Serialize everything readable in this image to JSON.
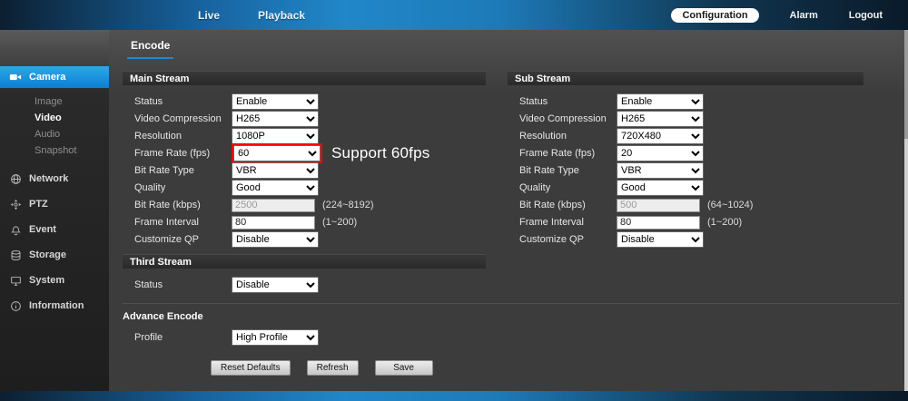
{
  "topbar": {
    "live": "Live",
    "playback": "Playback",
    "configuration": "Configuration",
    "alarm": "Alarm",
    "logout": "Logout"
  },
  "sidebar": {
    "camera": {
      "label": "Camera"
    },
    "camera_children": [
      {
        "label": "Image"
      },
      {
        "label": "Video"
      },
      {
        "label": "Audio"
      },
      {
        "label": "Snapshot"
      }
    ],
    "items": [
      {
        "label": "Network"
      },
      {
        "label": "PTZ"
      },
      {
        "label": "Event"
      },
      {
        "label": "Storage"
      },
      {
        "label": "System"
      },
      {
        "label": "Information"
      }
    ]
  },
  "page": {
    "tab": "Encode"
  },
  "main_stream": {
    "title": "Main Stream",
    "status": {
      "label": "Status",
      "value": "Enable"
    },
    "compression": {
      "label": "Video Compression",
      "value": "H265"
    },
    "resolution": {
      "label": "Resolution",
      "value": "1080P"
    },
    "framerate": {
      "label": "Frame Rate (fps)",
      "value": "60"
    },
    "bitrate_type": {
      "label": "Bit Rate Type",
      "value": "VBR"
    },
    "quality": {
      "label": "Quality",
      "value": "Good"
    },
    "bitrate": {
      "label": "Bit Rate (kbps)",
      "value": "2500",
      "range": "(224~8192)"
    },
    "frame_interval": {
      "label": "Frame Interval",
      "value": "80",
      "range": "(1~200)"
    },
    "customize_qp": {
      "label": "Customize QP",
      "value": "Disable"
    }
  },
  "annotation": {
    "text": "Support 60fps",
    "highlight_color": "#ff0000"
  },
  "sub_stream": {
    "title": "Sub Stream",
    "status": {
      "label": "Status",
      "value": "Enable"
    },
    "compression": {
      "label": "Video Compression",
      "value": "H265"
    },
    "resolution": {
      "label": "Resolution",
      "value": "720X480"
    },
    "framerate": {
      "label": "Frame Rate (fps)",
      "value": "20"
    },
    "bitrate_type": {
      "label": "Bit Rate Type",
      "value": "VBR"
    },
    "quality": {
      "label": "Quality",
      "value": "Good"
    },
    "bitrate": {
      "label": "Bit Rate (kbps)",
      "value": "500",
      "range": "(64~1024)"
    },
    "frame_interval": {
      "label": "Frame Interval",
      "value": "80",
      "range": "(1~200)"
    },
    "customize_qp": {
      "label": "Customize QP",
      "value": "Disable"
    }
  },
  "third_stream": {
    "title": "Third Stream",
    "status": {
      "label": "Status",
      "value": "Disable"
    }
  },
  "advance": {
    "title": "Advance Encode",
    "profile": {
      "label": "Profile",
      "value": "High Profile"
    }
  },
  "buttons": {
    "reset": "Reset Defaults",
    "refresh": "Refresh",
    "save": "Save"
  }
}
